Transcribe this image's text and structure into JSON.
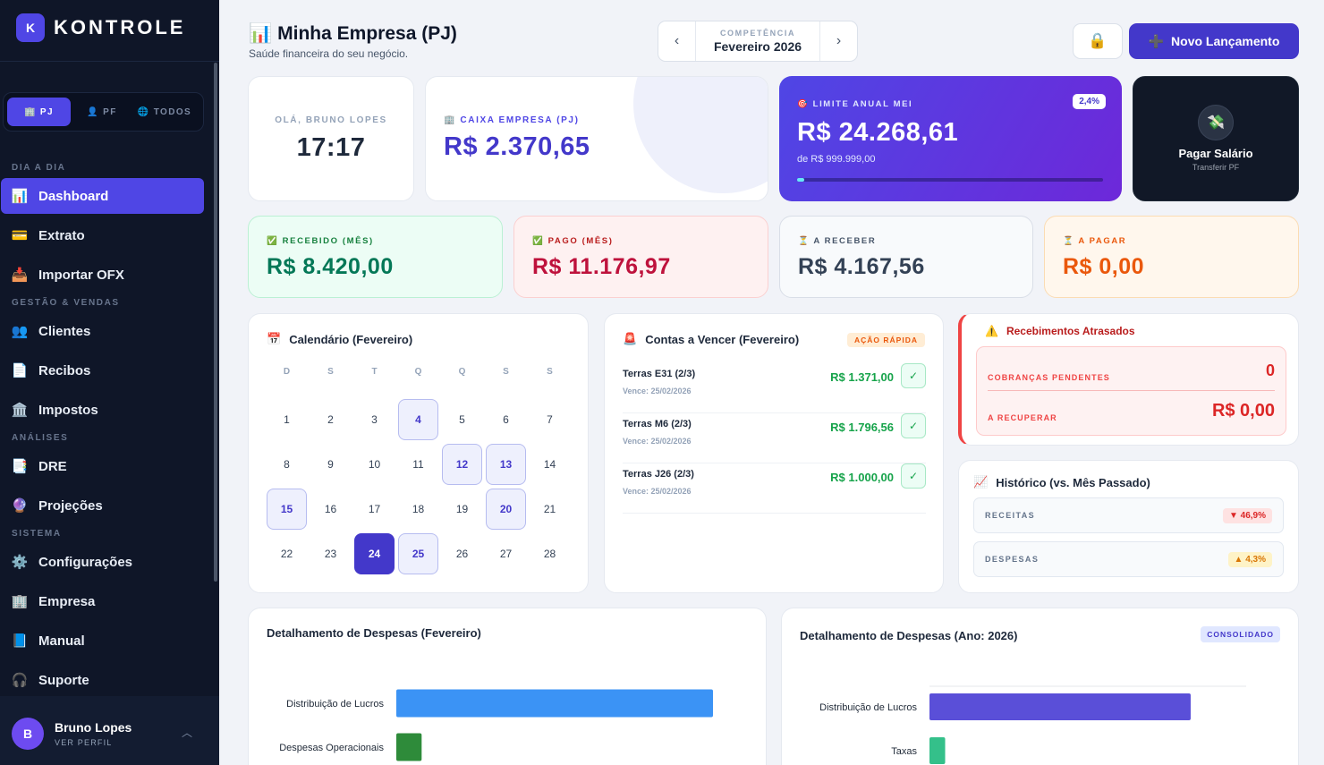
{
  "brand": {
    "initial": "K",
    "name": "KONTROLE"
  },
  "scope": [
    {
      "label": "PJ",
      "icon": "🏢",
      "active": true
    },
    {
      "label": "PF",
      "icon": "👤",
      "active": false
    },
    {
      "label": "TODOS",
      "icon": "🌐",
      "active": false
    }
  ],
  "nav": {
    "sections": [
      "DIA A DIA",
      "GESTÃO & VENDAS",
      "ANÁLISES",
      "SISTEMA"
    ],
    "items": [
      {
        "label": "Dashboard",
        "icon": "📊"
      },
      {
        "label": "Extrato",
        "icon": "💳"
      },
      {
        "label": "Importar OFX",
        "icon": "📥"
      },
      {
        "label": "Clientes",
        "icon": "👥"
      },
      {
        "label": "Recibos",
        "icon": "📄"
      },
      {
        "label": "Impostos",
        "icon": "🏛️"
      },
      {
        "label": "DRE",
        "icon": "📑"
      },
      {
        "label": "Projeções",
        "icon": "🔮"
      },
      {
        "label": "Configurações",
        "icon": "⚙️"
      },
      {
        "label": "Empresa",
        "icon": "🏢"
      },
      {
        "label": "Manual",
        "icon": "📘"
      },
      {
        "label": "Suporte",
        "icon": "🎧"
      }
    ]
  },
  "user": {
    "initial": "B",
    "name": "Bruno Lopes",
    "sub": "VER PERFIL"
  },
  "header": {
    "icon": "📊",
    "title": "Minha Empresa (PJ)",
    "subtitle": "Saúde financeira do seu negócio.",
    "period_label": "COMPETÊNCIA",
    "period_value": "Fevereiro 2026",
    "new_button": "Novo Lançamento",
    "new_icon": "➕",
    "lock_icon": "🔒"
  },
  "greeting": {
    "label": "OLÁ, BRUNO LOPES",
    "time": "17:17"
  },
  "cash": {
    "label": "🏢 CAIXA EMPRESA (PJ)",
    "value": "R$ 2.370,65"
  },
  "mei": {
    "label": "🎯 LIMITE ANUAL MEI",
    "percent": "2,4%",
    "percent_value": 2.4,
    "value": "R$ 24.268,61",
    "sub": "de R$ 999.999,00"
  },
  "salary": {
    "icon": "💸",
    "title": "Pagar Salário",
    "sub": "Transferir PF"
  },
  "stats": [
    {
      "label": "✅ RECEBIDO (MÊS)",
      "value": "R$ 8.420,00"
    },
    {
      "label": "✅ PAGO (MÊS)",
      "value": "R$ 11.176,97"
    },
    {
      "label": "⏳ A RECEBER",
      "value": "R$ 4.167,56"
    },
    {
      "label": "⏳ A PAGAR",
      "value": "R$ 0,00"
    }
  ],
  "calendar": {
    "title": "Calendário (Fevereiro)",
    "icon": "📅",
    "weekdays": [
      "D",
      "S",
      "T",
      "Q",
      "Q",
      "S",
      "S"
    ],
    "days": [
      1,
      2,
      3,
      4,
      5,
      6,
      7,
      8,
      9,
      10,
      11,
      12,
      13,
      14,
      15,
      16,
      17,
      18,
      19,
      20,
      21,
      22,
      23,
      24,
      25,
      26,
      27,
      28
    ],
    "marked": [
      4,
      12,
      13,
      15,
      20,
      25
    ],
    "today": 24
  },
  "bills": {
    "title": "Contas a Vencer (Fevereiro)",
    "icon": "🚨",
    "badge": "AÇÃO RÁPIDA",
    "items": [
      {
        "name": "Terras E31 (2/3)",
        "due": "Vence: 25/02/2026",
        "amount": "R$ 1.371,00"
      },
      {
        "name": "Terras M6 (2/3)",
        "due": "Vence: 25/02/2026",
        "amount": "R$ 1.796,56"
      },
      {
        "name": "Terras J26 (2/3)",
        "due": "Vence: 25/02/2026",
        "amount": "R$ 1.000,00"
      }
    ],
    "check": "✓"
  },
  "overdue": {
    "title": "Recebimentos Atrasados",
    "icon": "⚠️",
    "pending_label": "COBRANÇAS PENDENTES",
    "pending_value": "0",
    "recover_label": "A RECUPERAR",
    "recover_value": "R$ 0,00"
  },
  "history": {
    "title": "Histórico (vs. Mês Passado)",
    "icon": "📈",
    "rows": [
      {
        "label": "RECEITAS",
        "badge": "▼ 46,9%"
      },
      {
        "label": "DESPESAS",
        "badge": "▲ 4,3%"
      }
    ]
  },
  "chart_data": [
    {
      "type": "bar",
      "orientation": "horizontal",
      "title": "Detalhamento de Despesas (Fevereiro)",
      "categories": [
        "Distribuição de Lucros",
        "Despesas Operacionais"
      ],
      "values": [
        8000,
        640
      ],
      "xlim": [
        0,
        8000
      ],
      "colors": [
        "#3b93f5",
        "#2e8b3a"
      ]
    },
    {
      "type": "bar",
      "orientation": "horizontal",
      "title": "Detalhamento de Despesas (Ano: 2026)",
      "badge": "CONSOLIDADO",
      "categories": [
        "Distribuição de Lucros",
        "Taxas"
      ],
      "values": [
        8000,
        480
      ],
      "xlim": [
        0,
        9700
      ],
      "colors": [
        "#5a4fd8",
        "#34c08a"
      ]
    }
  ]
}
